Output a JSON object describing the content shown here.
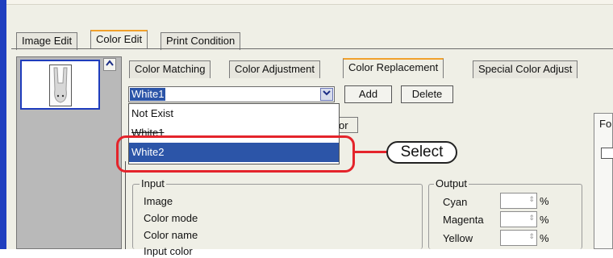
{
  "main_tabs": [
    "Image Edit",
    "Color Edit",
    "Print Condition"
  ],
  "sub_tabs": [
    "Color Matching",
    "Color Adjustment",
    "Color Replacement",
    "Special Color Adjust"
  ],
  "combo": {
    "selected": "White1"
  },
  "buttons": {
    "add": "Add",
    "delete": "Delete"
  },
  "dropdown": {
    "options": [
      "Not Exist",
      "White1",
      "White2"
    ],
    "highlighted": "White2"
  },
  "partial_tab": "or",
  "right_pane_label": "Fo",
  "callout_label": "Select",
  "input_group": {
    "title": "Input",
    "rows": [
      "Image",
      "Color mode",
      "Color name",
      "Input color"
    ]
  },
  "output_group": {
    "title": "Output",
    "rows": [
      {
        "label": "Cyan",
        "unit": "%"
      },
      {
        "label": "Magenta",
        "unit": "%"
      },
      {
        "label": "Yellow",
        "unit": "%"
      }
    ]
  },
  "colors": {
    "selection": "#2c55a8",
    "active_tab_accent": "#f1a12c",
    "callout": "#e4242b",
    "window_bg": "#efefe6"
  },
  "icons": {
    "scroll_up": "chevron-up-icon",
    "combo_arrow": "chevron-down-icon",
    "spinner": "spinner-arrows-icon"
  }
}
